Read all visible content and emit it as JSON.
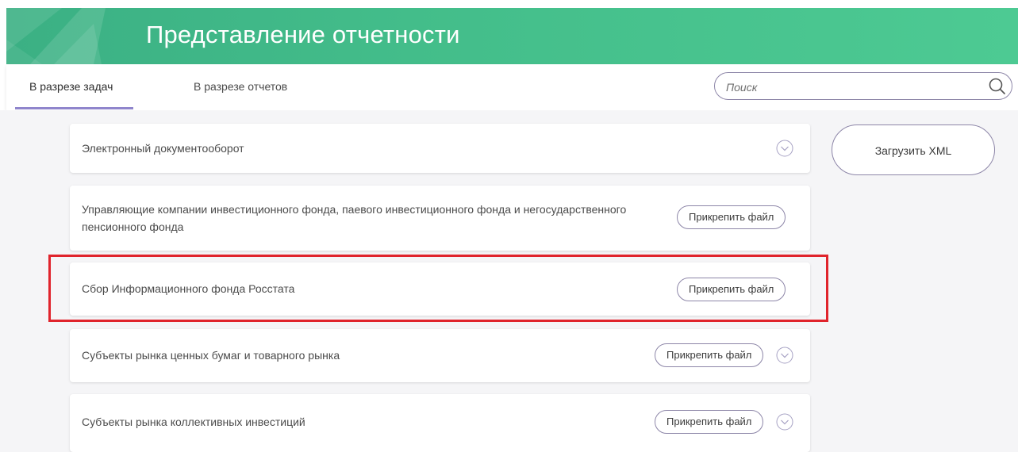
{
  "header": {
    "title": "Представление отчетности",
    "accent_color": "#43bd8a"
  },
  "tabs": [
    {
      "label": "В разрезе задач",
      "active": true
    },
    {
      "label": "В разрезе отчетов",
      "active": false
    }
  ],
  "search": {
    "placeholder": "Поиск",
    "value": "",
    "icon": "search-icon"
  },
  "sidebar": {
    "upload_xml_label": "Загрузить XML"
  },
  "cards": [
    {
      "title": "Электронный документооборот",
      "has_attach": false,
      "has_chevron": true
    },
    {
      "title": "Управляющие компании инвестиционного фонда, паевого инвестиционного фонда и негосударственного пенсионного фонда",
      "has_attach": true,
      "attach_label": "Прикрепить файл",
      "has_chevron": false
    },
    {
      "title": "Сбор Информационного фонда Росстата",
      "has_attach": true,
      "attach_label": "Прикрепить файл",
      "has_chevron": false,
      "highlighted": true
    },
    {
      "title": "Субъекты рынка ценных бумаг и товарного рынка",
      "has_attach": true,
      "attach_label": "Прикрепить файл",
      "has_chevron": true
    },
    {
      "title": "Субъекты рынка коллективных инвестиций",
      "has_attach": true,
      "attach_label": "Прикрепить файл",
      "has_chevron": true
    }
  ],
  "highlight_color": "#e0242c"
}
